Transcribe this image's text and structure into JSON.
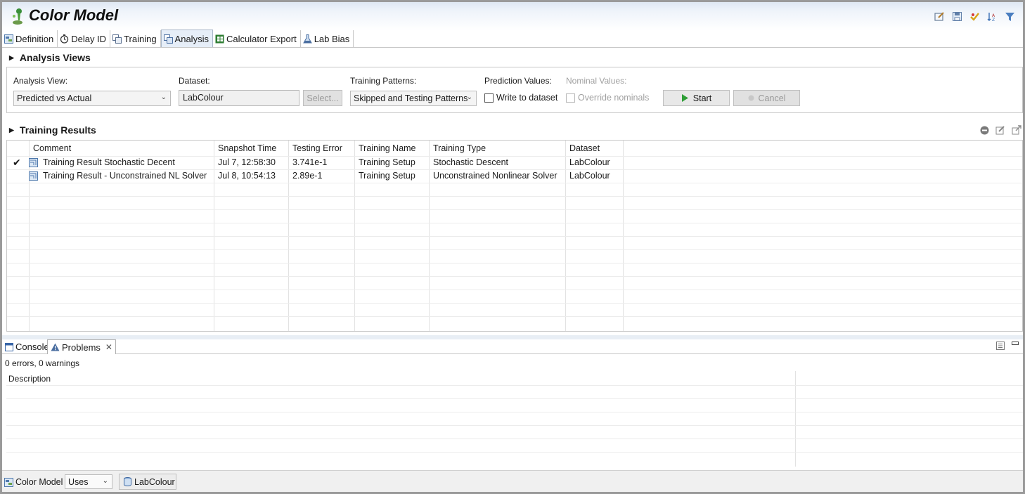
{
  "window": {
    "title": "Color Model"
  },
  "title_tools": [
    "edit-icon",
    "save-icon",
    "check-icon",
    "sort-icon",
    "filter-icon"
  ],
  "tabs": [
    {
      "label": "Definition",
      "icon": "definition-icon"
    },
    {
      "label": "Delay ID",
      "icon": "clock-icon"
    },
    {
      "label": "Training",
      "icon": "training-icon"
    },
    {
      "label": "Analysis",
      "icon": "analysis-icon",
      "active": true
    },
    {
      "label": "Calculator Export",
      "icon": "spreadsheet-icon"
    },
    {
      "label": "Lab Bias",
      "icon": "flask-icon"
    }
  ],
  "analysis_views": {
    "header": "Analysis Views",
    "analysis_view_label": "Analysis View:",
    "analysis_view_value": "Predicted vs Actual",
    "dataset_label": "Dataset:",
    "dataset_value": "LabColour",
    "select_button": "Select...",
    "training_patterns_label": "Training Patterns:",
    "training_patterns_value": "Skipped and Testing Patterns",
    "prediction_values_label": "Prediction Values:",
    "write_to_dataset": "Write to dataset",
    "nominal_values_label": "Nominal Values:",
    "override_nominals": "Override nominals",
    "start_button": "Start",
    "cancel_button": "Cancel"
  },
  "training_results": {
    "header": "Training Results",
    "columns": [
      "Comment",
      "Snapshot Time",
      "Testing Error",
      "Training Name",
      "Training Type",
      "Dataset"
    ],
    "rows": [
      {
        "checked": true,
        "comment": "Training Result Stochastic Decent",
        "snapshot_time": "Jul 7, 12:58:30",
        "testing_error": "3.741e-1",
        "training_name": "Training Setup",
        "training_type": "Stochastic Descent",
        "dataset": "LabColour"
      },
      {
        "checked": false,
        "comment": "Training Result - Unconstrained NL Solver",
        "snapshot_time": "Jul 8, 10:54:13",
        "testing_error": "2.89e-1",
        "training_name": "Training Setup",
        "training_type": "Unconstrained Nonlinear Solver",
        "dataset": "LabColour"
      }
    ]
  },
  "bottom_panel": {
    "tabs": [
      {
        "label": "Console"
      },
      {
        "label": "Problems",
        "active": true
      }
    ],
    "summary": "0 errors, 0 warnings",
    "column": "Description"
  },
  "statusbar": {
    "model": "Color Model",
    "relation_value": "Uses",
    "dataset": "LabColour"
  }
}
